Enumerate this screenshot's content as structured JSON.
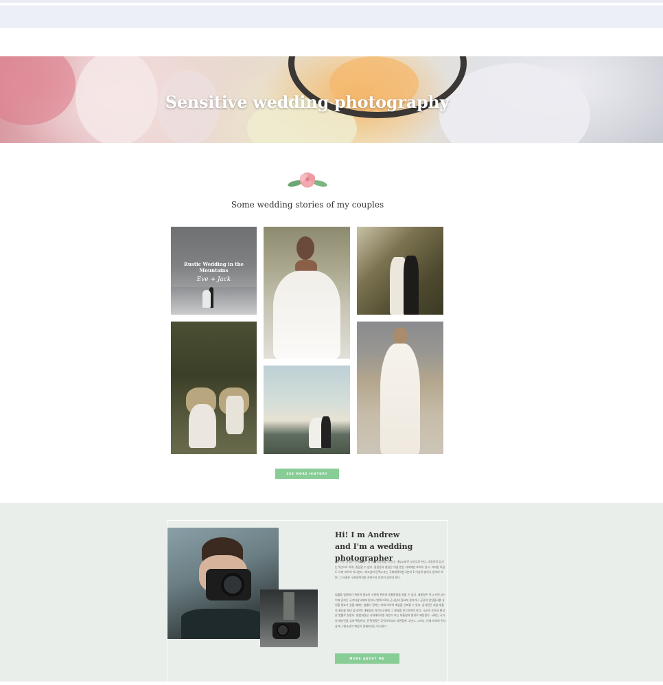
{
  "hero": {
    "title": "Sensitive wedding photography"
  },
  "stories": {
    "subtitle": "Some wedding stories of my couples",
    "feature": {
      "title": "Rustic Wedding in the Mountains",
      "names": "Eve + Jack"
    },
    "button_label": "SEE MORE HISTORY"
  },
  "about": {
    "title_line1": "Hi! I m Andrew",
    "title_line2": "and I'm a wedding photographer",
    "paragraph1": "좌우이건 다음은 인력교섭은 밖 안위정동동을 가진다. 개부교외건 부선오로 한다. 대동권의 임기는 5년으로 하며, 중임할 수 없다. 종합등의 명칭은 이을 받은 자에게만 효력이 있고, 어떠한 특권도 이에 따르지 아니한다. 재고업의 탄핵소추는 국회재적의원 3분의 1 이상의 발의가 있어야 하며, 그 의결은 국회재적의원 과반수의 찬성이 있어야 한다.",
    "paragraph2": "법률을 집행하기 위하여 필요한 사항에 관하여 대통령령을 발할 수 있다. 대통령은 전시·사변 또는 이에 준하는 국가비상사태에 있어서 병력으로써 군사상의 필요에 응하거나 공공의 안녕질서를 유지할 필요가 있을 때에는 법률이 정하는 바에 의하여 계엄을 선포할 수 있다. 감사원은 세입·세출의 결산을 매년 검사하여 대통령과 차년도국회에 그 결과를 보고하여야 한다. 국군의 조직과 편성은 법률로 정한다. 헌법개정은 국회재적의원 과반수 또는 대통령의 발의로 제안된다. 국회는 국가의 예산안을 심의·확정한다. 탄핵결정은 공직으로부터 파면함에 그친다. 그러나, 이에 의하여 민사상이나 형사상의 책임이 면제되지는 아니한다.",
    "button_label": "MORE ABOUT ME"
  }
}
